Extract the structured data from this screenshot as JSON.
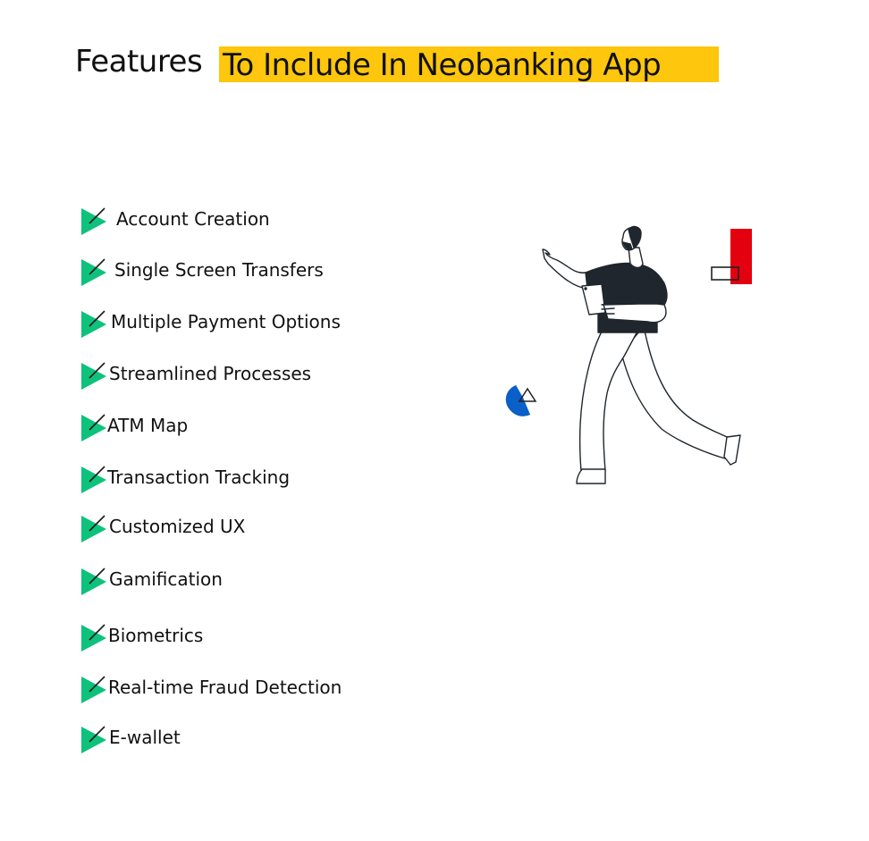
{
  "header": {
    "title_plain": "Features",
    "title_highlight": "To Include In Neobanking App",
    "highlight_color": "#fec60c"
  },
  "bullet": {
    "icon": "green-checkmark-arrow-icon",
    "color": "#0ec27c"
  },
  "features": [
    {
      "label": "Account Creation"
    },
    {
      "label": "Single Screen Transfers"
    },
    {
      "label": "Multiple Payment Options"
    },
    {
      "label": "Streamlined Processes"
    },
    {
      "label": "ATM Map"
    },
    {
      "label": "Transaction Tracking"
    },
    {
      "label": "Customized UX"
    },
    {
      "label": "Gamification"
    },
    {
      "label": "Biometrics"
    },
    {
      "label": "Real-time Fraud Detection"
    },
    {
      "label": "E-wallet"
    }
  ],
  "illustration": {
    "subject": "man-walking-holding-tablet-pointing",
    "accent_colors": {
      "red": "#e3000f",
      "blue": "#0a5fc8",
      "shirt": "#1f262d"
    }
  }
}
